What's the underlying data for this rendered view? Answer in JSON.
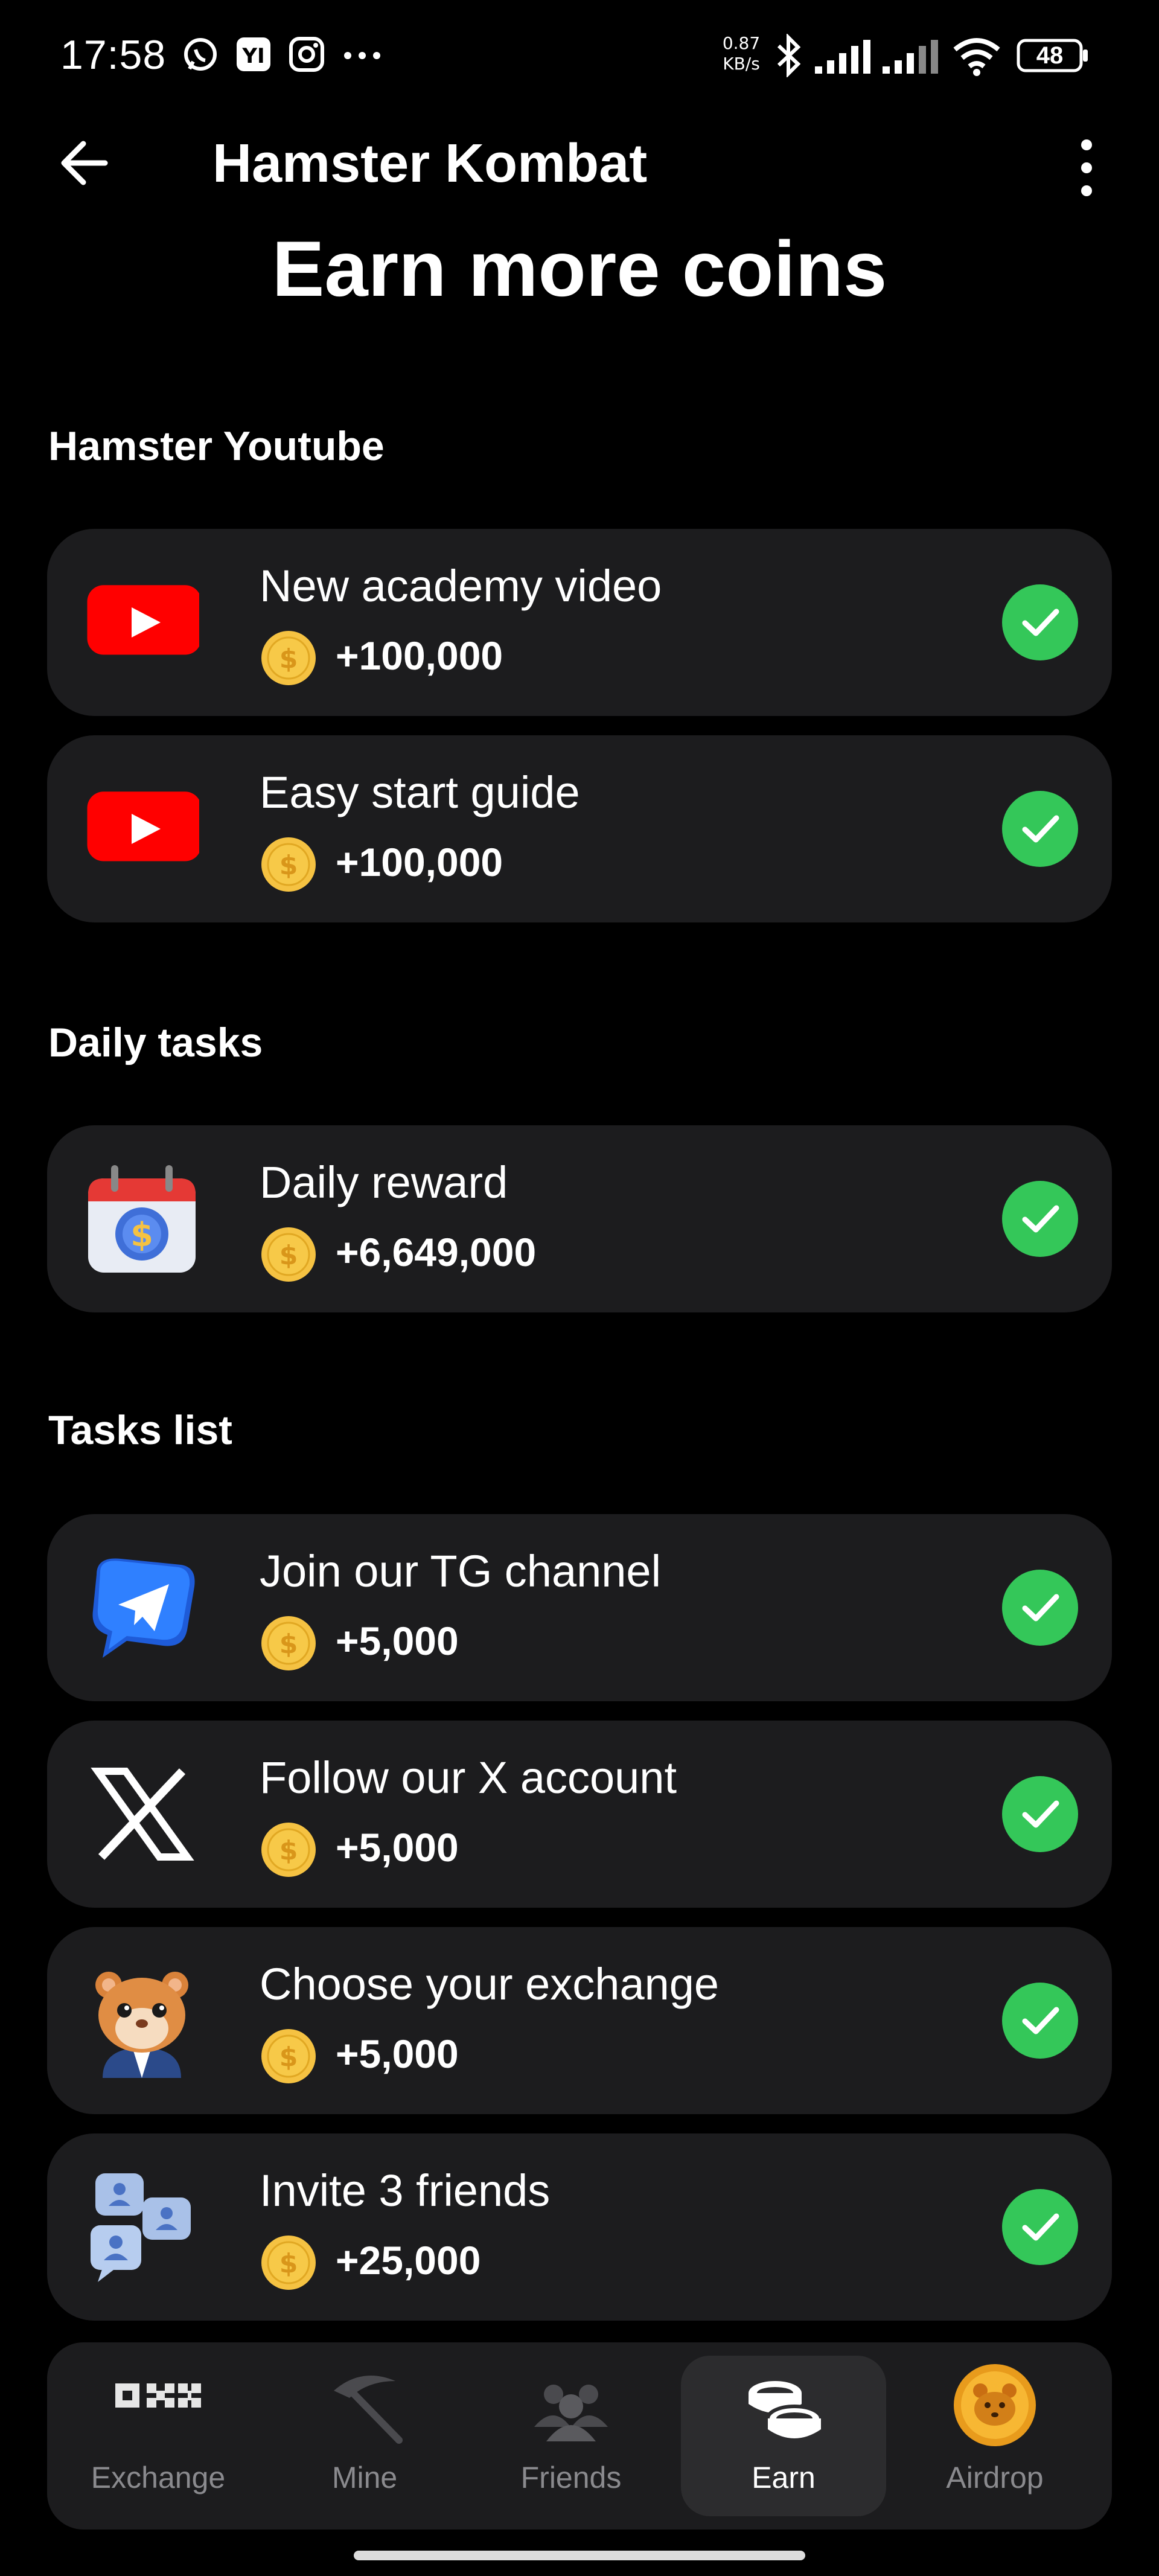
{
  "status_bar": {
    "time": "17:58",
    "net_speed_value": "0.87",
    "net_speed_unit": "KB/s",
    "battery": "48",
    "left_icons": [
      "whatsapp-icon",
      "app-icon",
      "instagram-icon",
      "more-dots-icon"
    ],
    "right_icons": [
      "bluetooth-icon",
      "signal-icon",
      "signal-icon",
      "wifi-icon",
      "battery-icon"
    ]
  },
  "header": {
    "title": "Hamster Kombat",
    "back_icon": "arrow-left-icon",
    "menu_icon": "kebab-menu-icon"
  },
  "page_heading": "Earn more coins",
  "sections": [
    {
      "title": "Hamster Youtube",
      "items": [
        {
          "title": "New academy video",
          "reward": "+100,000",
          "icon": "youtube-icon",
          "done": true
        },
        {
          "title": "Easy start guide",
          "reward": "+100,000",
          "icon": "youtube-icon",
          "done": true
        }
      ]
    },
    {
      "title": "Daily tasks",
      "items": [
        {
          "title": "Daily reward",
          "reward": "+6,649,000",
          "icon": "calendar-coin-icon",
          "done": true
        }
      ]
    },
    {
      "title": "Tasks list",
      "items": [
        {
          "title": "Join our TG channel",
          "reward": "+5,000",
          "icon": "telegram-icon",
          "done": true
        },
        {
          "title": "Follow our X account",
          "reward": "+5,000",
          "icon": "x-logo-icon",
          "done": true
        },
        {
          "title": "Choose your exchange",
          "reward": "+5,000",
          "icon": "hamster-icon",
          "done": true
        },
        {
          "title": "Invite 3 friends",
          "reward": "+25,000",
          "icon": "friends-chat-icon",
          "done": true
        }
      ]
    }
  ],
  "nav": {
    "items": [
      {
        "label": "Exchange",
        "icon": "okx-icon",
        "active": false
      },
      {
        "label": "Mine",
        "icon": "pickaxe-icon",
        "active": false
      },
      {
        "label": "Friends",
        "icon": "friends-icon",
        "active": false
      },
      {
        "label": "Earn",
        "icon": "coins-icon",
        "active": true
      },
      {
        "label": "Airdrop",
        "icon": "hamster-coin-icon",
        "active": false
      }
    ]
  },
  "colors": {
    "background": "#000000",
    "card": "#1c1c1e",
    "check_green": "#34c759",
    "coin_gold": "#f5c242",
    "youtube_red": "#ff0000",
    "nav_inactive": "#8a8a8e"
  }
}
